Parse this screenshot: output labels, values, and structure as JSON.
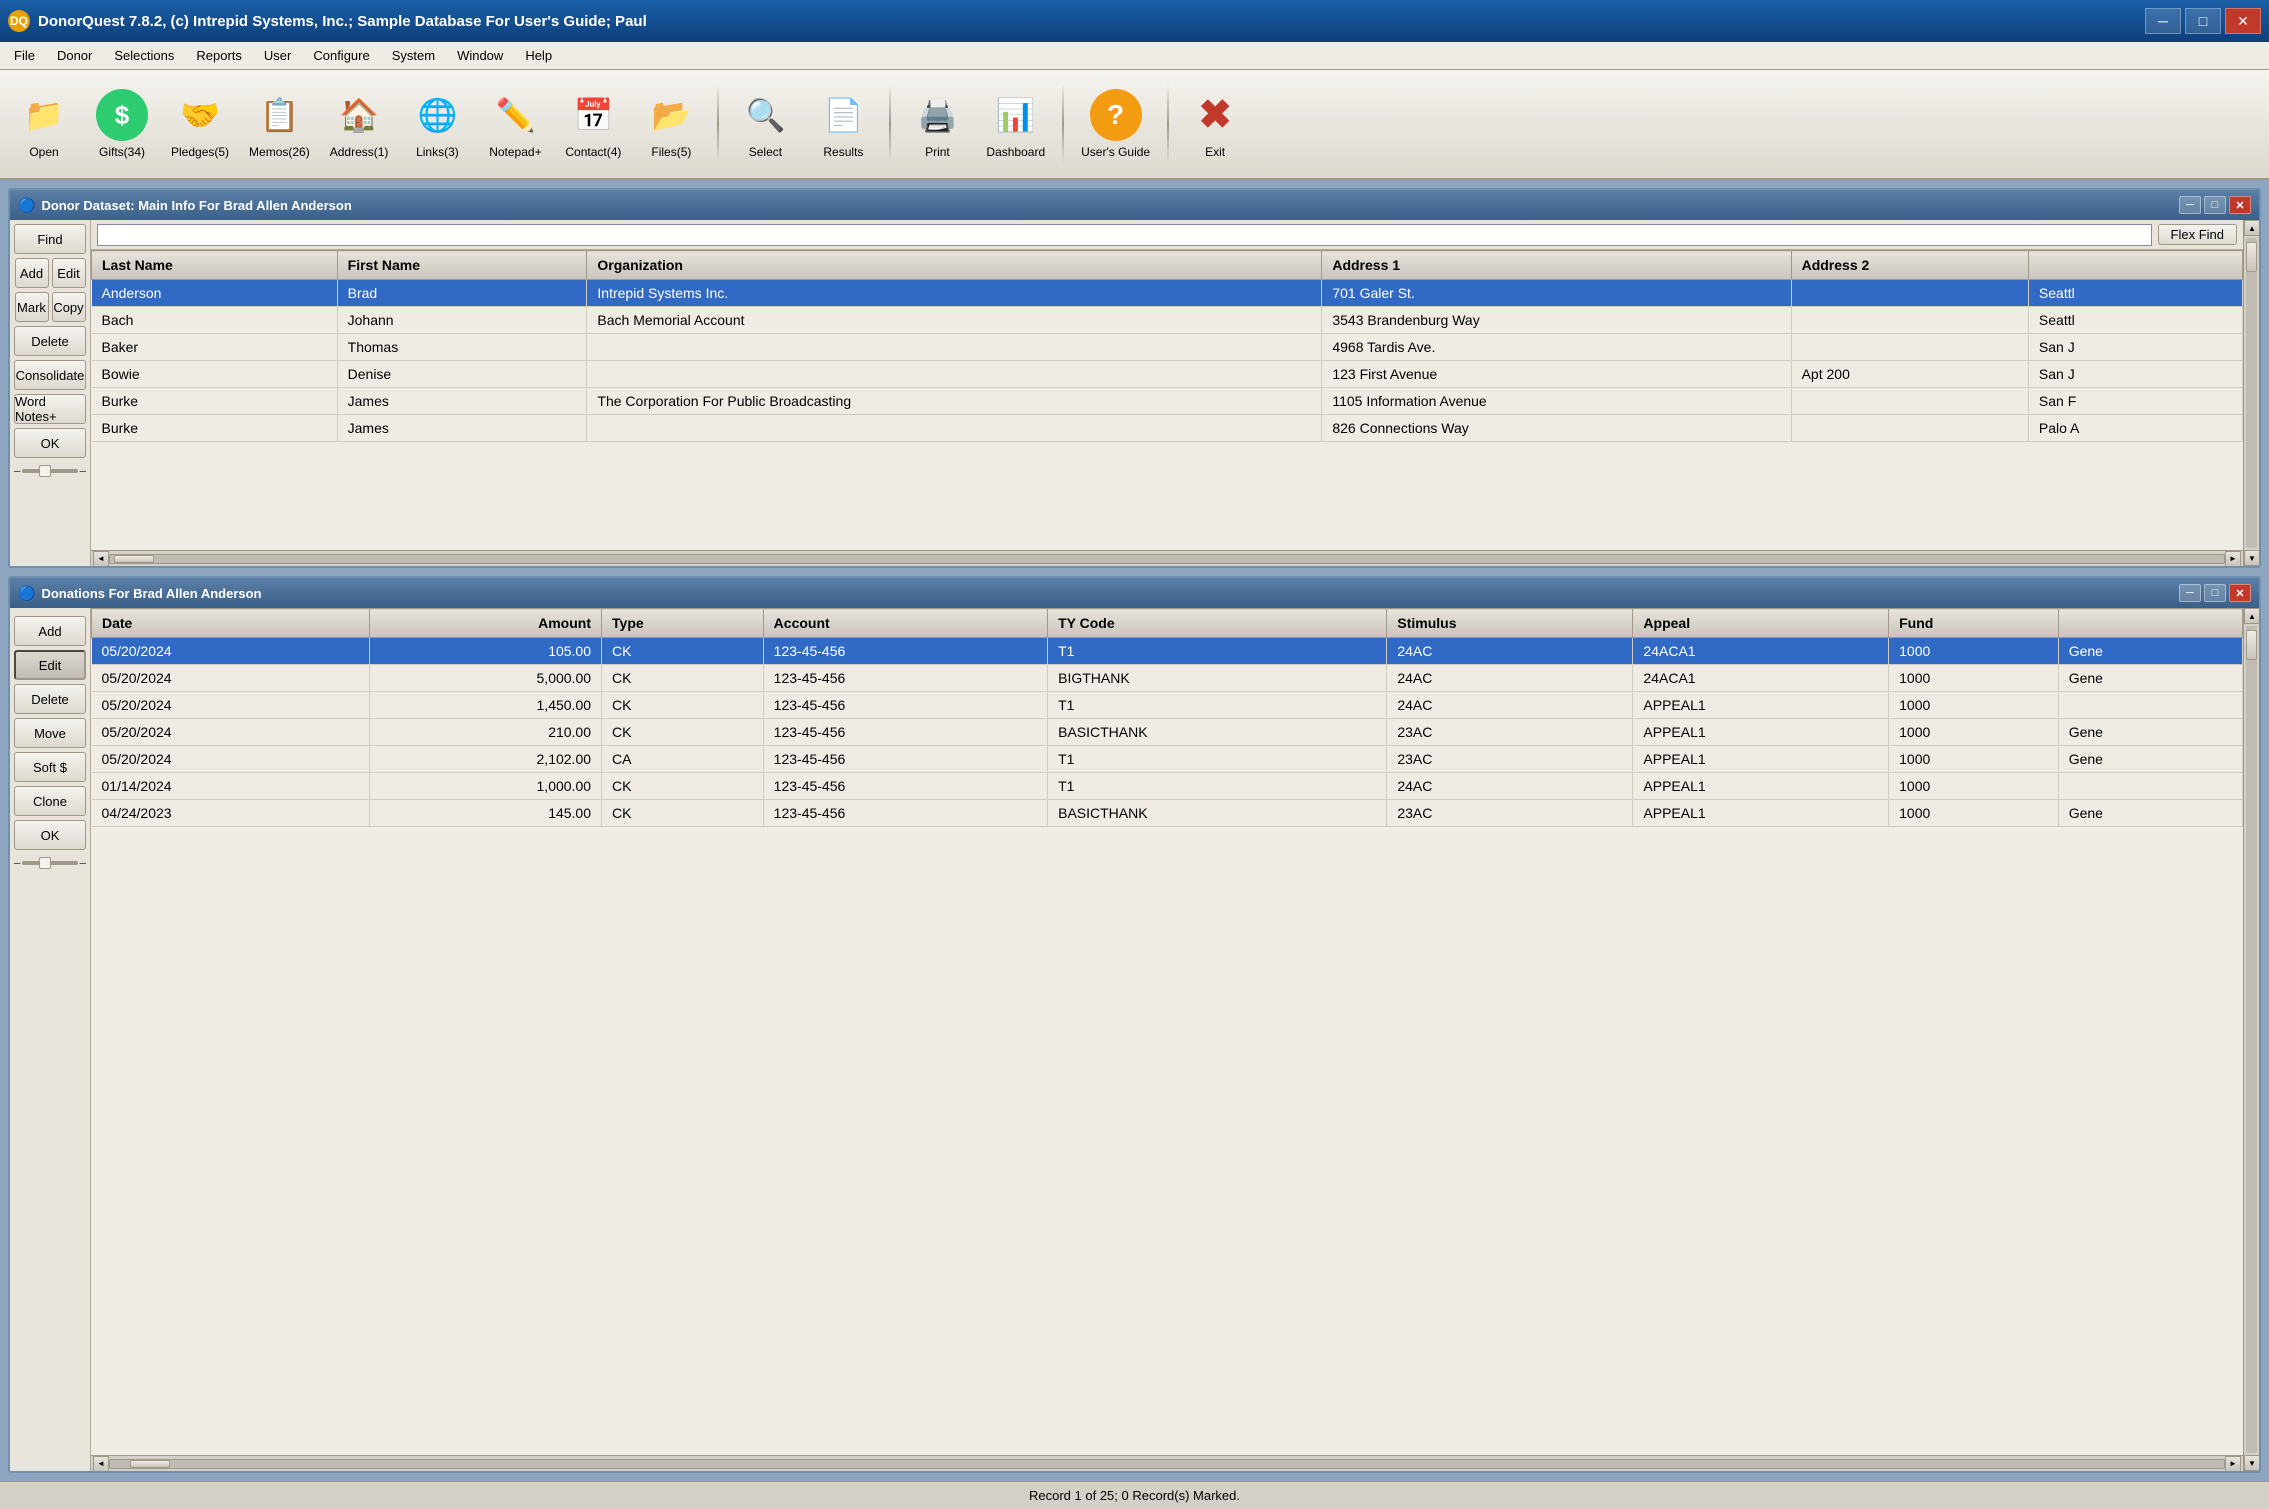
{
  "titleBar": {
    "title": "DonorQuest 7.8.2, (c) Intrepid Systems, Inc.; Sample Database For User's Guide; Paul",
    "icon": "DQ"
  },
  "menuBar": {
    "items": [
      "File",
      "Donor",
      "Selections",
      "Reports",
      "User",
      "Configure",
      "System",
      "Window",
      "Help"
    ]
  },
  "toolbar": {
    "buttons": [
      {
        "id": "open",
        "label": "Open",
        "icon": "📁",
        "iconClass": "icon-open"
      },
      {
        "id": "gifts",
        "label": "Gifts(34)",
        "icon": "💰",
        "iconClass": "icon-gifts"
      },
      {
        "id": "pledges",
        "label": "Pledges(5)",
        "icon": "🤝",
        "iconClass": "icon-pledges"
      },
      {
        "id": "memos",
        "label": "Memos(26)",
        "icon": "📋",
        "iconClass": "icon-memos"
      },
      {
        "id": "address",
        "label": "Address(1)",
        "icon": "🏠",
        "iconClass": "icon-address"
      },
      {
        "id": "links",
        "label": "Links(3)",
        "icon": "🌐",
        "iconClass": "icon-links"
      },
      {
        "id": "notepad",
        "label": "Notepad+",
        "icon": "✏️",
        "iconClass": "icon-notepad"
      },
      {
        "id": "contact",
        "label": "Contact(4)",
        "icon": "📅",
        "iconClass": "icon-contact"
      },
      {
        "id": "files",
        "label": "Files(5)",
        "icon": "📂",
        "iconClass": "icon-files"
      },
      {
        "id": "select",
        "label": "Select",
        "icon": "🔍",
        "iconClass": "icon-select"
      },
      {
        "id": "results",
        "label": "Results",
        "icon": "📄",
        "iconClass": "icon-results"
      },
      {
        "id": "print",
        "label": "Print",
        "icon": "🖨️",
        "iconClass": "icon-print"
      },
      {
        "id": "dashboard",
        "label": "Dashboard",
        "icon": "📊",
        "iconClass": "icon-dashboard"
      },
      {
        "id": "guide",
        "label": "User's Guide",
        "icon": "❓",
        "iconClass": "icon-guide"
      },
      {
        "id": "exit",
        "label": "Exit",
        "icon": "✖",
        "iconClass": "icon-exit"
      }
    ]
  },
  "donorDataset": {
    "title": "Donor Dataset: Main Info For Brad Allen Anderson",
    "findLabel": "Find",
    "flexFindLabel": "Flex Find",
    "findPlaceholder": "",
    "sidebar": {
      "buttons": [
        "Add",
        "Edit",
        "Mark",
        "Copy",
        "Delete",
        "Consolidate",
        "Word Notes+",
        "OK"
      ]
    },
    "columns": [
      "Last Name",
      "First Name",
      "Organization",
      "Address 1",
      "Address 2"
    ],
    "rows": [
      {
        "lastName": "Anderson",
        "firstName": "Brad",
        "organization": "Intrepid Systems Inc.",
        "address1": "701 Galer St.",
        "address2": "",
        "city": "Seattl",
        "selected": true
      },
      {
        "lastName": "Bach",
        "firstName": "Johann",
        "organization": "Bach Memorial Account",
        "address1": "3543 Brandenburg Way",
        "address2": "",
        "city": "Seattl",
        "selected": false
      },
      {
        "lastName": "Baker",
        "firstName": "Thomas",
        "organization": "",
        "address1": "4968 Tardis Ave.",
        "address2": "",
        "city": "San J",
        "selected": false
      },
      {
        "lastName": "Bowie",
        "firstName": "Denise",
        "organization": "",
        "address1": "123 First Avenue",
        "address2": "Apt 200",
        "city": "San J",
        "selected": false
      },
      {
        "lastName": "Burke",
        "firstName": "James",
        "organization": "The Corporation For Public Broadcasting",
        "address1": "1105 Information Avenue",
        "address2": "",
        "city": "San F",
        "selected": false
      },
      {
        "lastName": "Burke",
        "firstName": "James",
        "organization": "",
        "address1": "826 Connections Way",
        "address2": "",
        "city": "Palo A",
        "selected": false
      }
    ]
  },
  "donations": {
    "title": "Donations For Brad Allen Anderson",
    "sidebar": {
      "buttons": [
        "Add",
        "Edit",
        "Delete",
        "Move",
        "Soft $",
        "Clone",
        "OK"
      ]
    },
    "columns": [
      "Date",
      "Amount",
      "Type",
      "Account",
      "TY Code",
      "Stimulus",
      "Appeal",
      "Fund"
    ],
    "rows": [
      {
        "date": "05/20/2024",
        "amount": "105.00",
        "type": "CK",
        "account": "123-45-456",
        "tyCode": "T1",
        "stimulus": "24AC",
        "appeal": "24ACA1",
        "fund": "1000",
        "extra": "Gene",
        "selected": true
      },
      {
        "date": "05/20/2024",
        "amount": "5,000.00",
        "type": "CK",
        "account": "123-45-456",
        "tyCode": "BIGTHANK",
        "stimulus": "24AC",
        "appeal": "24ACA1",
        "fund": "1000",
        "extra": "Gene",
        "selected": false
      },
      {
        "date": "05/20/2024",
        "amount": "1,450.00",
        "type": "CK",
        "account": "123-45-456",
        "tyCode": "T1",
        "stimulus": "24AC",
        "appeal": "APPEAL1",
        "fund": "1000",
        "extra": "",
        "selected": false
      },
      {
        "date": "05/20/2024",
        "amount": "210.00",
        "type": "CK",
        "account": "123-45-456",
        "tyCode": "BASICTHANK",
        "stimulus": "23AC",
        "appeal": "APPEAL1",
        "fund": "1000",
        "extra": "Gene",
        "selected": false
      },
      {
        "date": "05/20/2024",
        "amount": "2,102.00",
        "type": "CA",
        "account": "123-45-456",
        "tyCode": "T1",
        "stimulus": "23AC",
        "appeal": "APPEAL1",
        "fund": "1000",
        "extra": "Gene",
        "selected": false
      },
      {
        "date": "01/14/2024",
        "amount": "1,000.00",
        "type": "CK",
        "account": "123-45-456",
        "tyCode": "T1",
        "stimulus": "24AC",
        "appeal": "APPEAL1",
        "fund": "1000",
        "extra": "",
        "selected": false
      },
      {
        "date": "04/24/2023",
        "amount": "145.00",
        "type": "CK",
        "account": "123-45-456",
        "tyCode": "BASICTHANK",
        "stimulus": "23AC",
        "appeal": "APPEAL1",
        "fund": "1000",
        "extra": "Gene",
        "selected": false
      }
    ]
  },
  "statusBar": {
    "text": "Record 1 of 25; 0 Record(s) Marked."
  }
}
